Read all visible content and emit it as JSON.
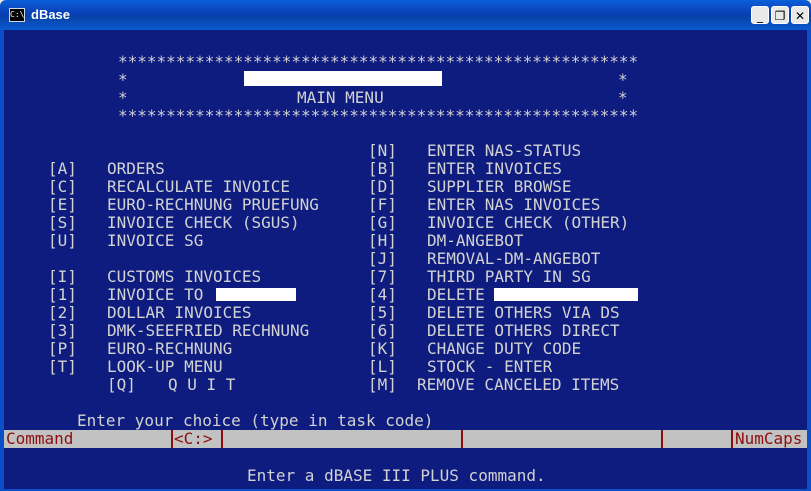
{
  "window": {
    "title": "dBase",
    "icon": "C:\\"
  },
  "header": {
    "stars_line": "******************************************************",
    "star": "*",
    "title": "MAIN MENU"
  },
  "menu": {
    "n_key": "[N]",
    "n_label": "ENTER NAS-STATUS",
    "left": [
      {
        "key": "[A]",
        "label": "ORDERS"
      },
      {
        "key": "[C]",
        "label": "RECALCULATE INVOICE"
      },
      {
        "key": "[E]",
        "label": "EURO-RECHNUNG PRUEFUNG"
      },
      {
        "key": "[S]",
        "label": "INVOICE CHECK (SGUS)"
      },
      {
        "key": "[U]",
        "label": "INVOICE SG"
      },
      {
        "key": "[I]",
        "label": "CUSTOMS INVOICES"
      },
      {
        "key": "[1]",
        "label": "INVOICE TO"
      },
      {
        "key": "[2]",
        "label": "DOLLAR INVOICES"
      },
      {
        "key": "[3]",
        "label": "DMK-SEEFRIED RECHNUNG"
      },
      {
        "key": "[P]",
        "label": "EURO-RECHNUNG"
      },
      {
        "key": "[T]",
        "label": "LOOK-UP MENU"
      }
    ],
    "right": [
      {
        "key": "[B]",
        "label": "ENTER INVOICES"
      },
      {
        "key": "[D]",
        "label": "SUPPLIER BROWSE"
      },
      {
        "key": "[F]",
        "label": "ENTER NAS INVOICES"
      },
      {
        "key": "[G]",
        "label": "INVOICE CHECK (OTHER)"
      },
      {
        "key": "[H]",
        "label": "DM-ANGEBOT"
      },
      {
        "key": "[J]",
        "label": "REMOVAL-DM-ANGEBOT"
      },
      {
        "key": "[7]",
        "label": "THIRD PARTY IN SG"
      },
      {
        "key": "[4]",
        "label": "DELETE"
      },
      {
        "key": "[5]",
        "label": "DELETE OTHERS VIA DS"
      },
      {
        "key": "[6]",
        "label": "DELETE OTHERS DIRECT"
      },
      {
        "key": "[K]",
        "label": "CHANGE DUTY CODE"
      },
      {
        "key": "[L]",
        "label": "STOCK - ENTER"
      }
    ],
    "quit_key": "[Q]",
    "quit_label": "Q U I T",
    "m_key": "[M]",
    "m_label": "REMOVE CANCELED ITEMS"
  },
  "prompt": "Enter your choice (type in task code)",
  "statusbar": {
    "command": "Command",
    "drive": "<C:>",
    "numcaps": "NumCaps"
  },
  "footer": "Enter a dBASE III PLUS command.",
  "colors": {
    "console_bg": "#0e1c80",
    "text": "#d2d2d2",
    "status_bg": "#c2c2c2",
    "status_text": "#8e0e0e"
  }
}
